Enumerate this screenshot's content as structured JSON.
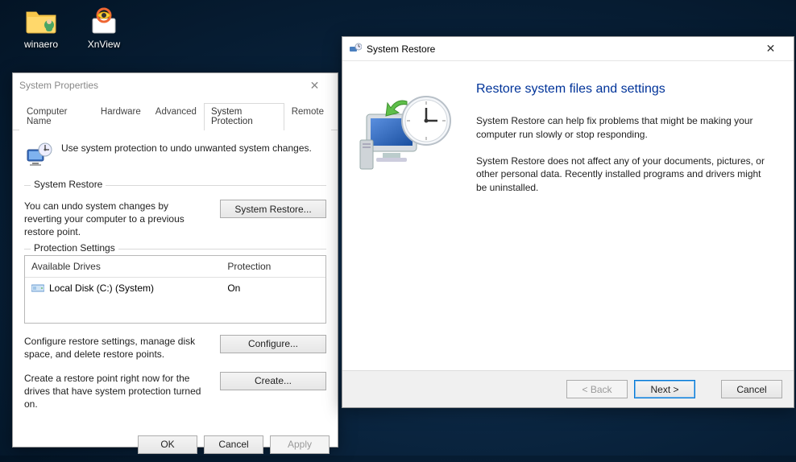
{
  "desktop": {
    "icons": [
      {
        "label": "winaero",
        "type": "folder-with-user"
      },
      {
        "label": "XnView",
        "type": "xnview"
      }
    ]
  },
  "sysprops": {
    "title": "System Properties",
    "tabs": [
      "Computer Name",
      "Hardware",
      "Advanced",
      "System Protection",
      "Remote"
    ],
    "active_tab_index": 3,
    "intro": "Use system protection to undo unwanted system changes.",
    "restore_group": {
      "legend": "System Restore",
      "text": "You can undo system changes by reverting your computer to a previous restore point.",
      "button": "System Restore..."
    },
    "protection_group": {
      "legend": "Protection Settings",
      "columns": [
        "Available Drives",
        "Protection"
      ],
      "rows": [
        {
          "drive": "Local Disk (C:) (System)",
          "protection": "On"
        }
      ],
      "configure_text": "Configure restore settings, manage disk space, and delete restore points.",
      "configure_btn": "Configure...",
      "create_text": "Create a restore point right now for the drives that have system protection turned on.",
      "create_btn": "Create..."
    },
    "buttons": {
      "ok": "OK",
      "cancel": "Cancel",
      "apply": "Apply"
    }
  },
  "restorewiz": {
    "title": "System Restore",
    "heading": "Restore system files and settings",
    "para1": "System Restore can help fix problems that might be making your computer run slowly or stop responding.",
    "para2": "System Restore does not affect any of your documents, pictures, or other personal data. Recently installed programs and drivers might be uninstalled.",
    "buttons": {
      "back": "< Back",
      "next": "Next >",
      "cancel": "Cancel"
    }
  }
}
